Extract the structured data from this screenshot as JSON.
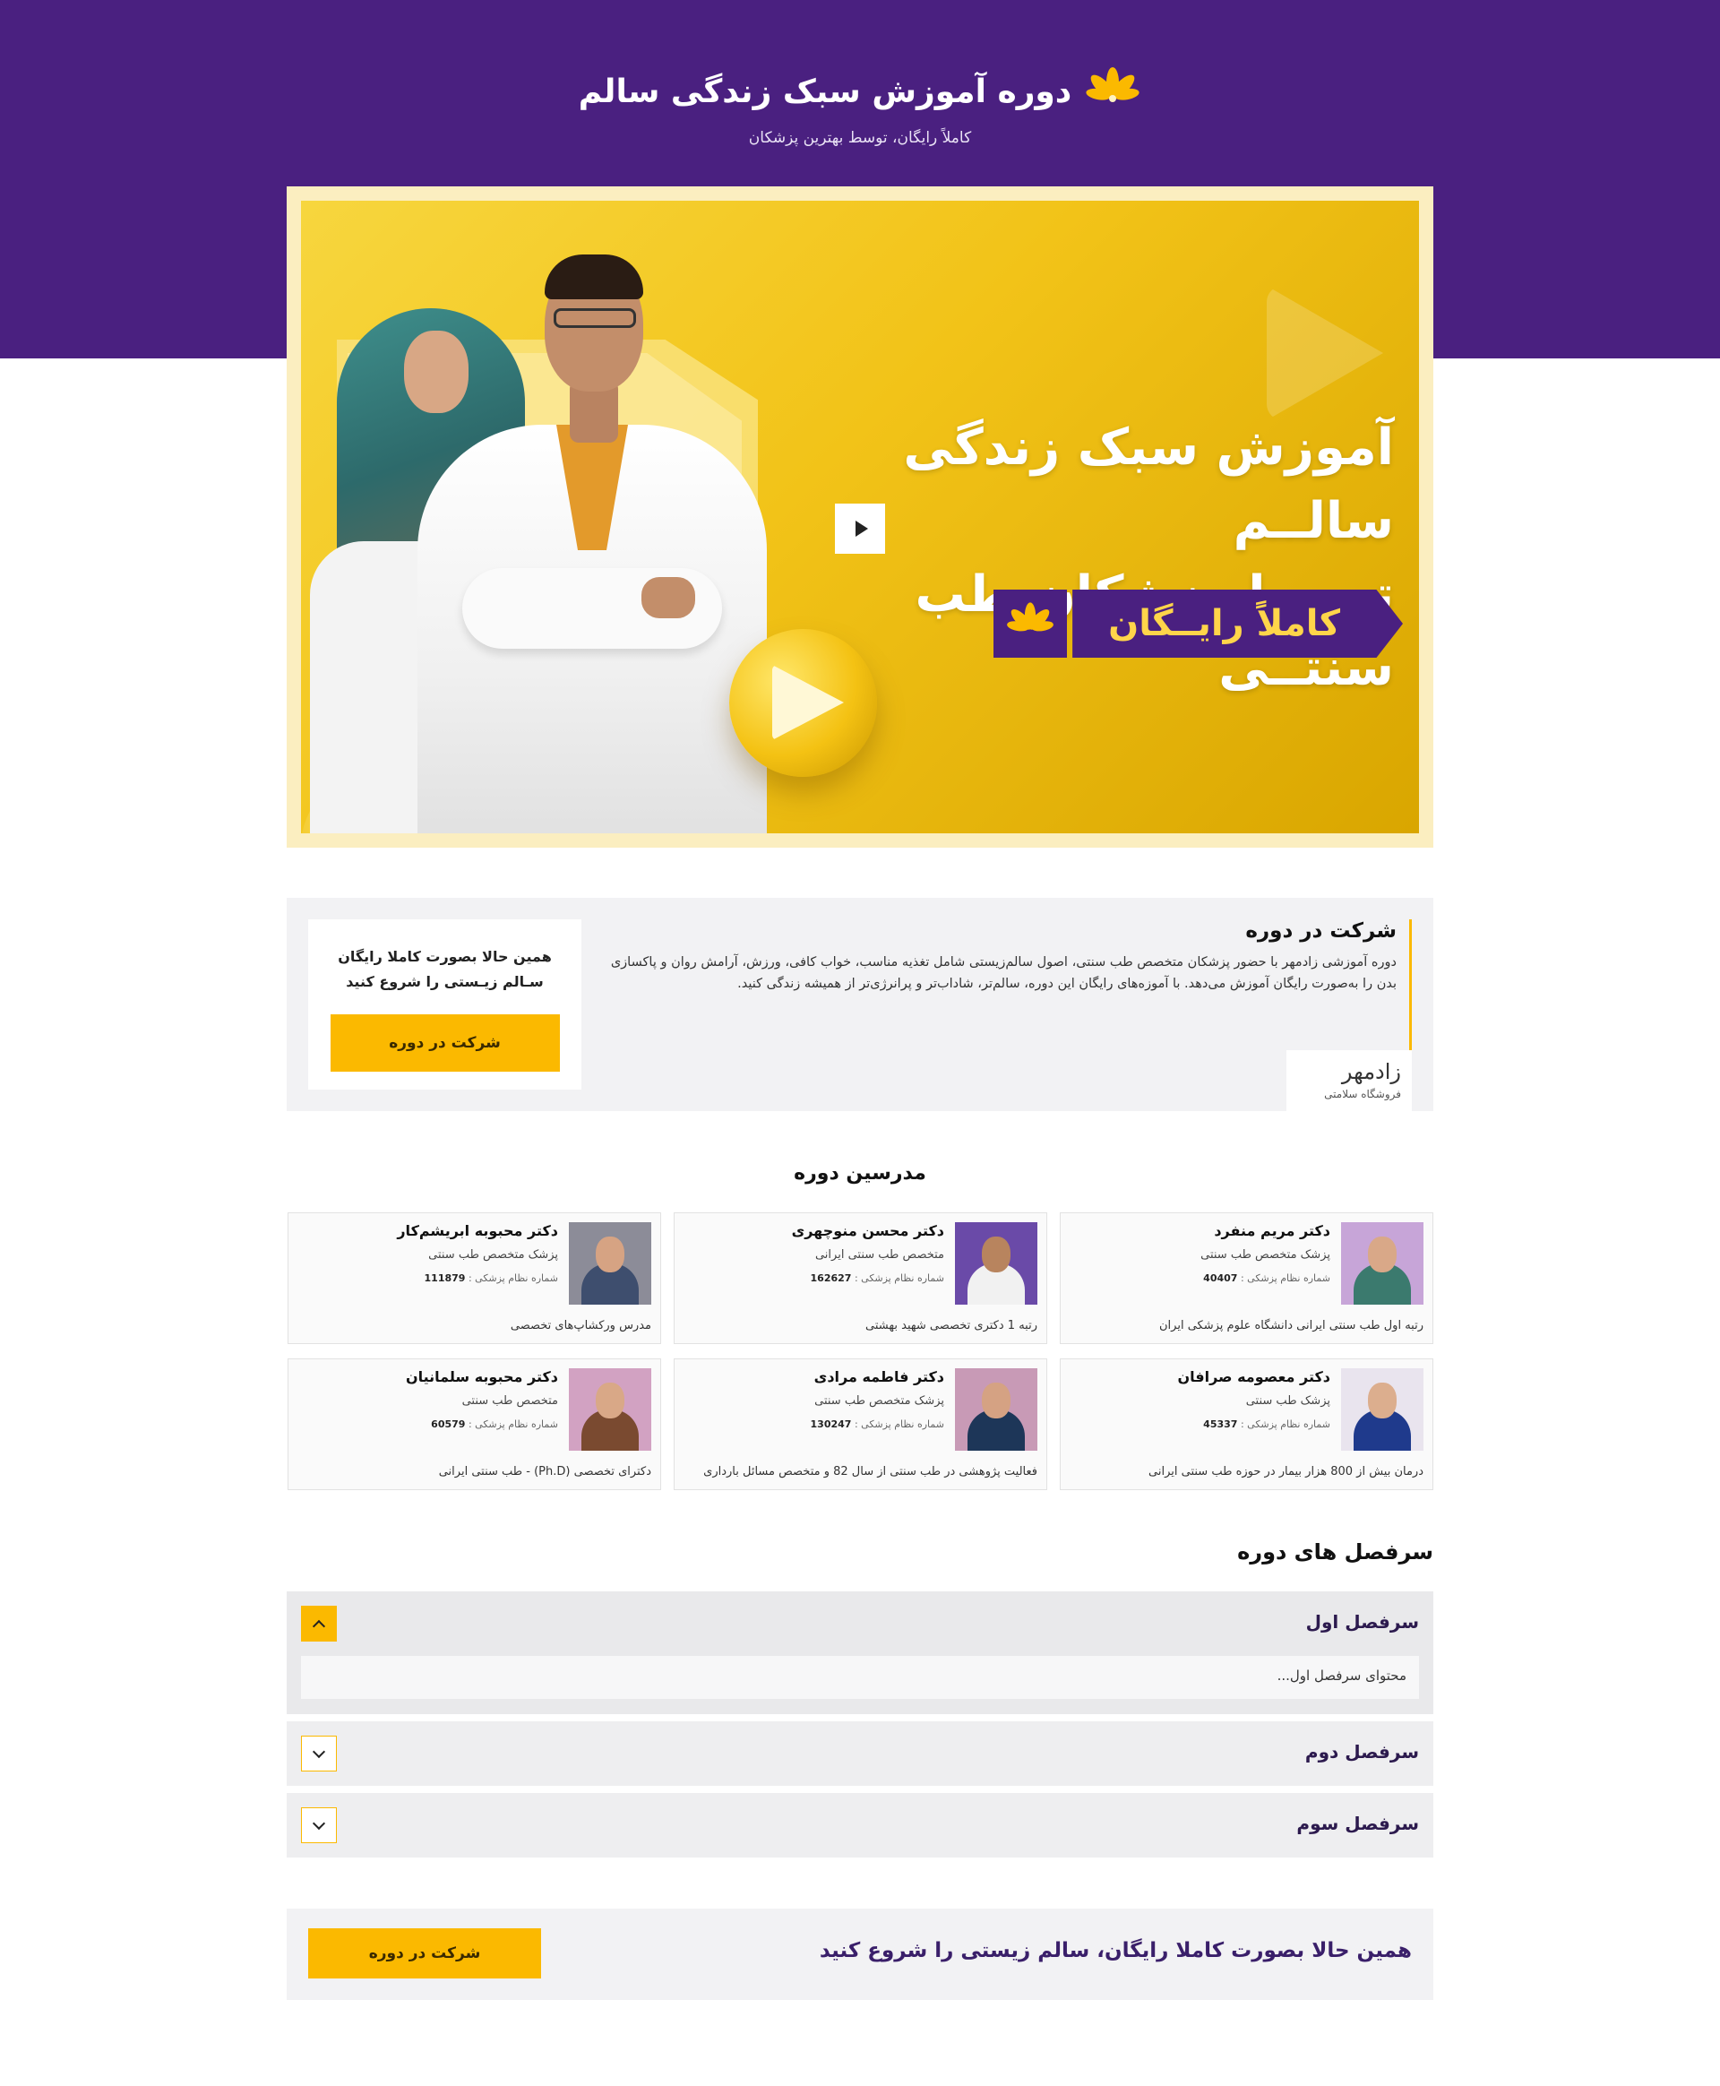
{
  "header": {
    "title": "دوره آموزش سبک زندگی سالم",
    "subtitle": "کاملاً رایگان، توسط بهترین پزشکان",
    "logo_icon": "saffron-flower-icon"
  },
  "hero": {
    "headline_line1": "آموزش سبک زندگی سالــم",
    "headline_line2": "توسط پزشکان طب سنتــی",
    "badge": "کاملاً رایــگان",
    "play_icon": "play-icon"
  },
  "join": {
    "title": "شرکت در دوره",
    "description": "دوره آموزشی زادمهر با حضور پزشکان متخصص طب سنتی، اصول سالم‌زیستی شامل تغذیه مناسب، خواب کافی، ورزش، آرامش روان و پاکسازی بدن را به‌صورت رایگان آموزش می‌دهد. با آموزه‌های رایگان این دوره، سالم‌تر، شاداب‌تر و پرانرژی‌تر از همیشه زندگی کنید.",
    "cta_line1": "همین حالا بصورت کاملا رایگان",
    "cta_line2": "سـالم زیـستی را شروع کنید",
    "button": "شرکت در دوره",
    "brand_name": "زادمهر",
    "brand_sub": "فروشگاه سلامتی"
  },
  "instructors": {
    "title": "مدرسین دوره",
    "code_label": "شماره نظام پزشکی :",
    "items": [
      {
        "name": "دکتر مریم منفرد",
        "spec": "پزشک متخصص طب سنتی",
        "code": "40407",
        "note": "رتبه اول طب سنتی ایرانی دانشگاه علوم پزشکی ایران",
        "photo_bg": "#c7a5d8",
        "scarf": "#3b7a6e",
        "skin": "#d9a888"
      },
      {
        "name": "دکتر محسن منوچهری",
        "spec": "متخصص طب سنتی ایرانی",
        "code": "162627",
        "note": "رتبه 1 دکتری تخصصی شهید بهشتی",
        "photo_bg": "#6a4aa8",
        "scarf": "#f1f1f1",
        "skin": "#b8845e"
      },
      {
        "name": "دکتر محبوبه ابریشم‌کار",
        "spec": "پزشک متخصص طب سنتی",
        "code": "111879",
        "note": "مدرس ورکشاپ‌های تخصصی",
        "photo_bg": "#8c8c98",
        "scarf": "#3e4e6e",
        "skin": "#d6a383"
      },
      {
        "name": "دکتر معصومه صرافان",
        "spec": "پزشک طب سنتی",
        "code": "45337",
        "note": "درمان بیش از 800 هزار بیمار در حوزه طب سنتی ایرانی",
        "photo_bg": "#e9e4ee",
        "scarf": "#1f3a8c",
        "skin": "#dcae8e"
      },
      {
        "name": "دکتر فاطمه مرادی",
        "spec": "پزشک متخصص طب سنتی",
        "code": "130247",
        "note": "فعالیت پژوهشی در طب سنتی از سال 82 و متخصص مسائل بارداری",
        "photo_bg": "#c89ab6",
        "scarf": "#1d3658",
        "skin": "#d5a283"
      },
      {
        "name": "دکتر محبوبه سلمانیان",
        "spec": "متخصص طب سنتی",
        "code": "60579",
        "note": "دکترای تخصصی (Ph.D) - طب سنتی ایرانی",
        "photo_bg": "#d2a2c2",
        "scarf": "#7a4a30",
        "skin": "#d9a887"
      }
    ]
  },
  "syllabus": {
    "title": "سرفصل های دوره",
    "sections": [
      {
        "label": "سرفصل اول",
        "content": "محتوای سرفصل اول..."
      },
      {
        "label": "سرفصل دوم"
      },
      {
        "label": "سرفصل سوم"
      }
    ]
  },
  "bottom_cta": {
    "text": "همین حالا بصورت کاملا رایگان، سالم زیستی را شروع کنید",
    "button": "شرکت در دوره"
  },
  "colors": {
    "brand_purple": "#4a2080",
    "accent_yellow": "#fbb900"
  }
}
